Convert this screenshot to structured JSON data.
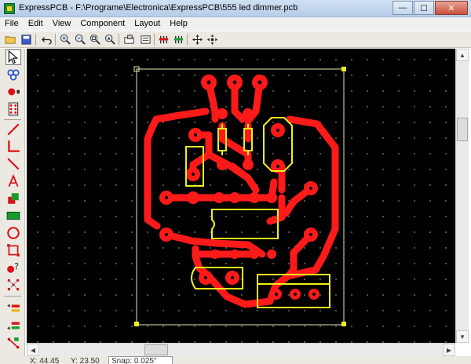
{
  "window": {
    "title": "ExpressPCB - F:\\Programe\\Electronica\\ExpressPCB\\555 led dimmer.pcb",
    "minimize_glyph": "—",
    "maximize_glyph": "☐",
    "close_glyph": "✕"
  },
  "menu": {
    "items": [
      {
        "label": "File"
      },
      {
        "label": "Edit"
      },
      {
        "label": "View"
      },
      {
        "label": "Component"
      },
      {
        "label": "Layout"
      },
      {
        "label": "Help"
      }
    ]
  },
  "toolbar": {
    "icons": [
      "open-folder-icon",
      "save-disk-icon",
      "undo-icon",
      "zoom-in-icon",
      "zoom-out-icon",
      "zoom-fit-icon",
      "zoom-selection-icon",
      "component-properties-icon",
      "top-layer-icon",
      "bottom-layer-icon",
      "pan-icon",
      "move-icon"
    ]
  },
  "left_tools": {
    "icons": [
      "pointer-icon",
      "zoom-tool-icon",
      "pad-icon",
      "component-icon",
      "trace-icon",
      "bend-icon",
      "line-icon",
      "text-icon",
      "copy-icon",
      "rectangle-fill-icon",
      "circle-icon",
      "board-outline-icon",
      "help-pointer-icon",
      "netlist-icon",
      "layer-top-icon",
      "layer-bottom-icon",
      "layer-both-icon"
    ]
  },
  "pcb": {
    "trace_color": "#ff1a1a",
    "silkscreen_color": "#f0f01a",
    "outline_color": "#e8e8b0",
    "background": "#000000"
  },
  "status": {
    "x_readout": "X: 44.45",
    "y_readout": "Y: 23.50",
    "snap_label": "Snap: 0.025\""
  }
}
